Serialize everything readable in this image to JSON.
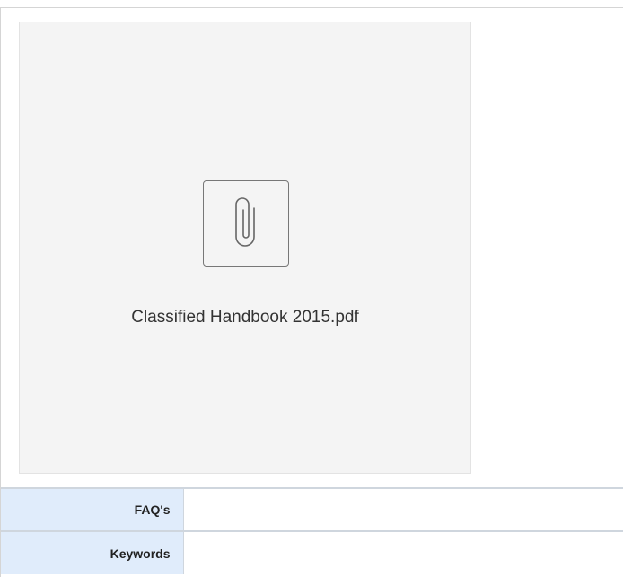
{
  "attachment": {
    "filename": "Classified Handbook 2015.pdf",
    "icon": "paperclip-icon"
  },
  "metadata": {
    "rows": [
      {
        "label": "FAQ's",
        "value": ""
      },
      {
        "label": "Keywords",
        "value": ""
      }
    ]
  },
  "colors": {
    "card_bg": "#f4f4f4",
    "label_bg": "#e0ecfb",
    "border": "#cfd6de"
  }
}
